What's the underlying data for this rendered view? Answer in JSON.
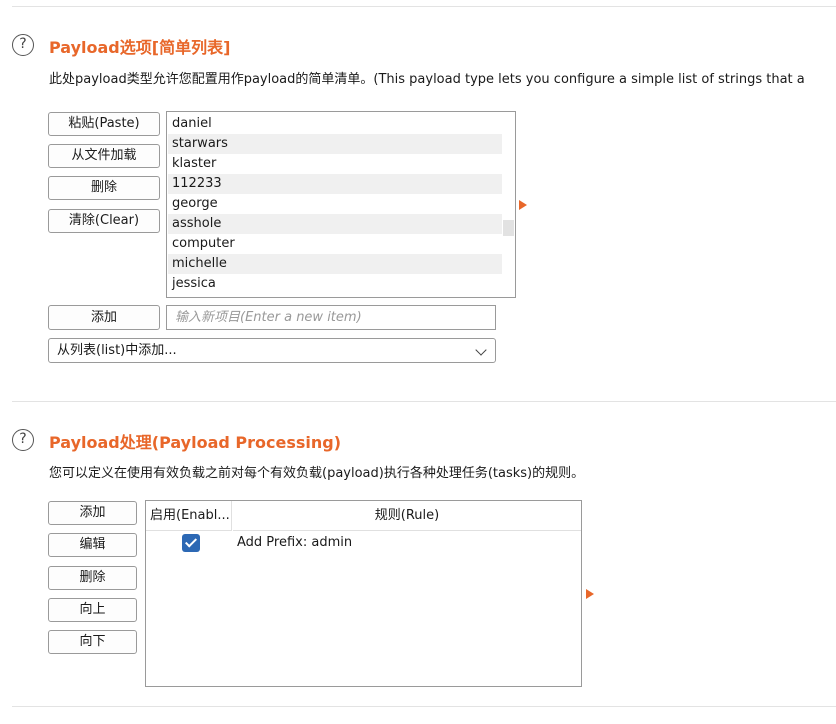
{
  "options": {
    "title": "Payload选项[简单列表]",
    "description": "此处payload类型允许您配置用作payload的简单清单。(This payload type lets you configure a simple list of strings that a",
    "buttons": {
      "paste": "粘贴(Paste)",
      "load": "从文件加载",
      "remove": "删除",
      "clear": "清除(Clear)",
      "add": "添加"
    },
    "items": [
      "daniel",
      "starwars",
      "klaster",
      "112233",
      "george",
      "asshole",
      "computer",
      "michelle",
      "jessica"
    ],
    "new_item_placeholder": "输入新项目(Enter a new item)",
    "add_from_list": "从列表(list)中添加..."
  },
  "processing": {
    "title": "Payload处理(Payload Processing)",
    "description": "您可以定义在使用有效负载之前对每个有效负载(payload)执行各种处理任务(tasks)的规则。",
    "buttons": {
      "add": "添加",
      "edit": "编辑",
      "remove": "删除",
      "up": "向上",
      "down": "向下"
    },
    "columns": {
      "enabled": "启用(Enabl...",
      "rule": "规则(Rule)"
    },
    "rules": [
      {
        "enabled": true,
        "rule": "Add Prefix: admin"
      }
    ]
  },
  "colors": {
    "accent": "#e8672a",
    "checkbox": "#2c68b4"
  }
}
